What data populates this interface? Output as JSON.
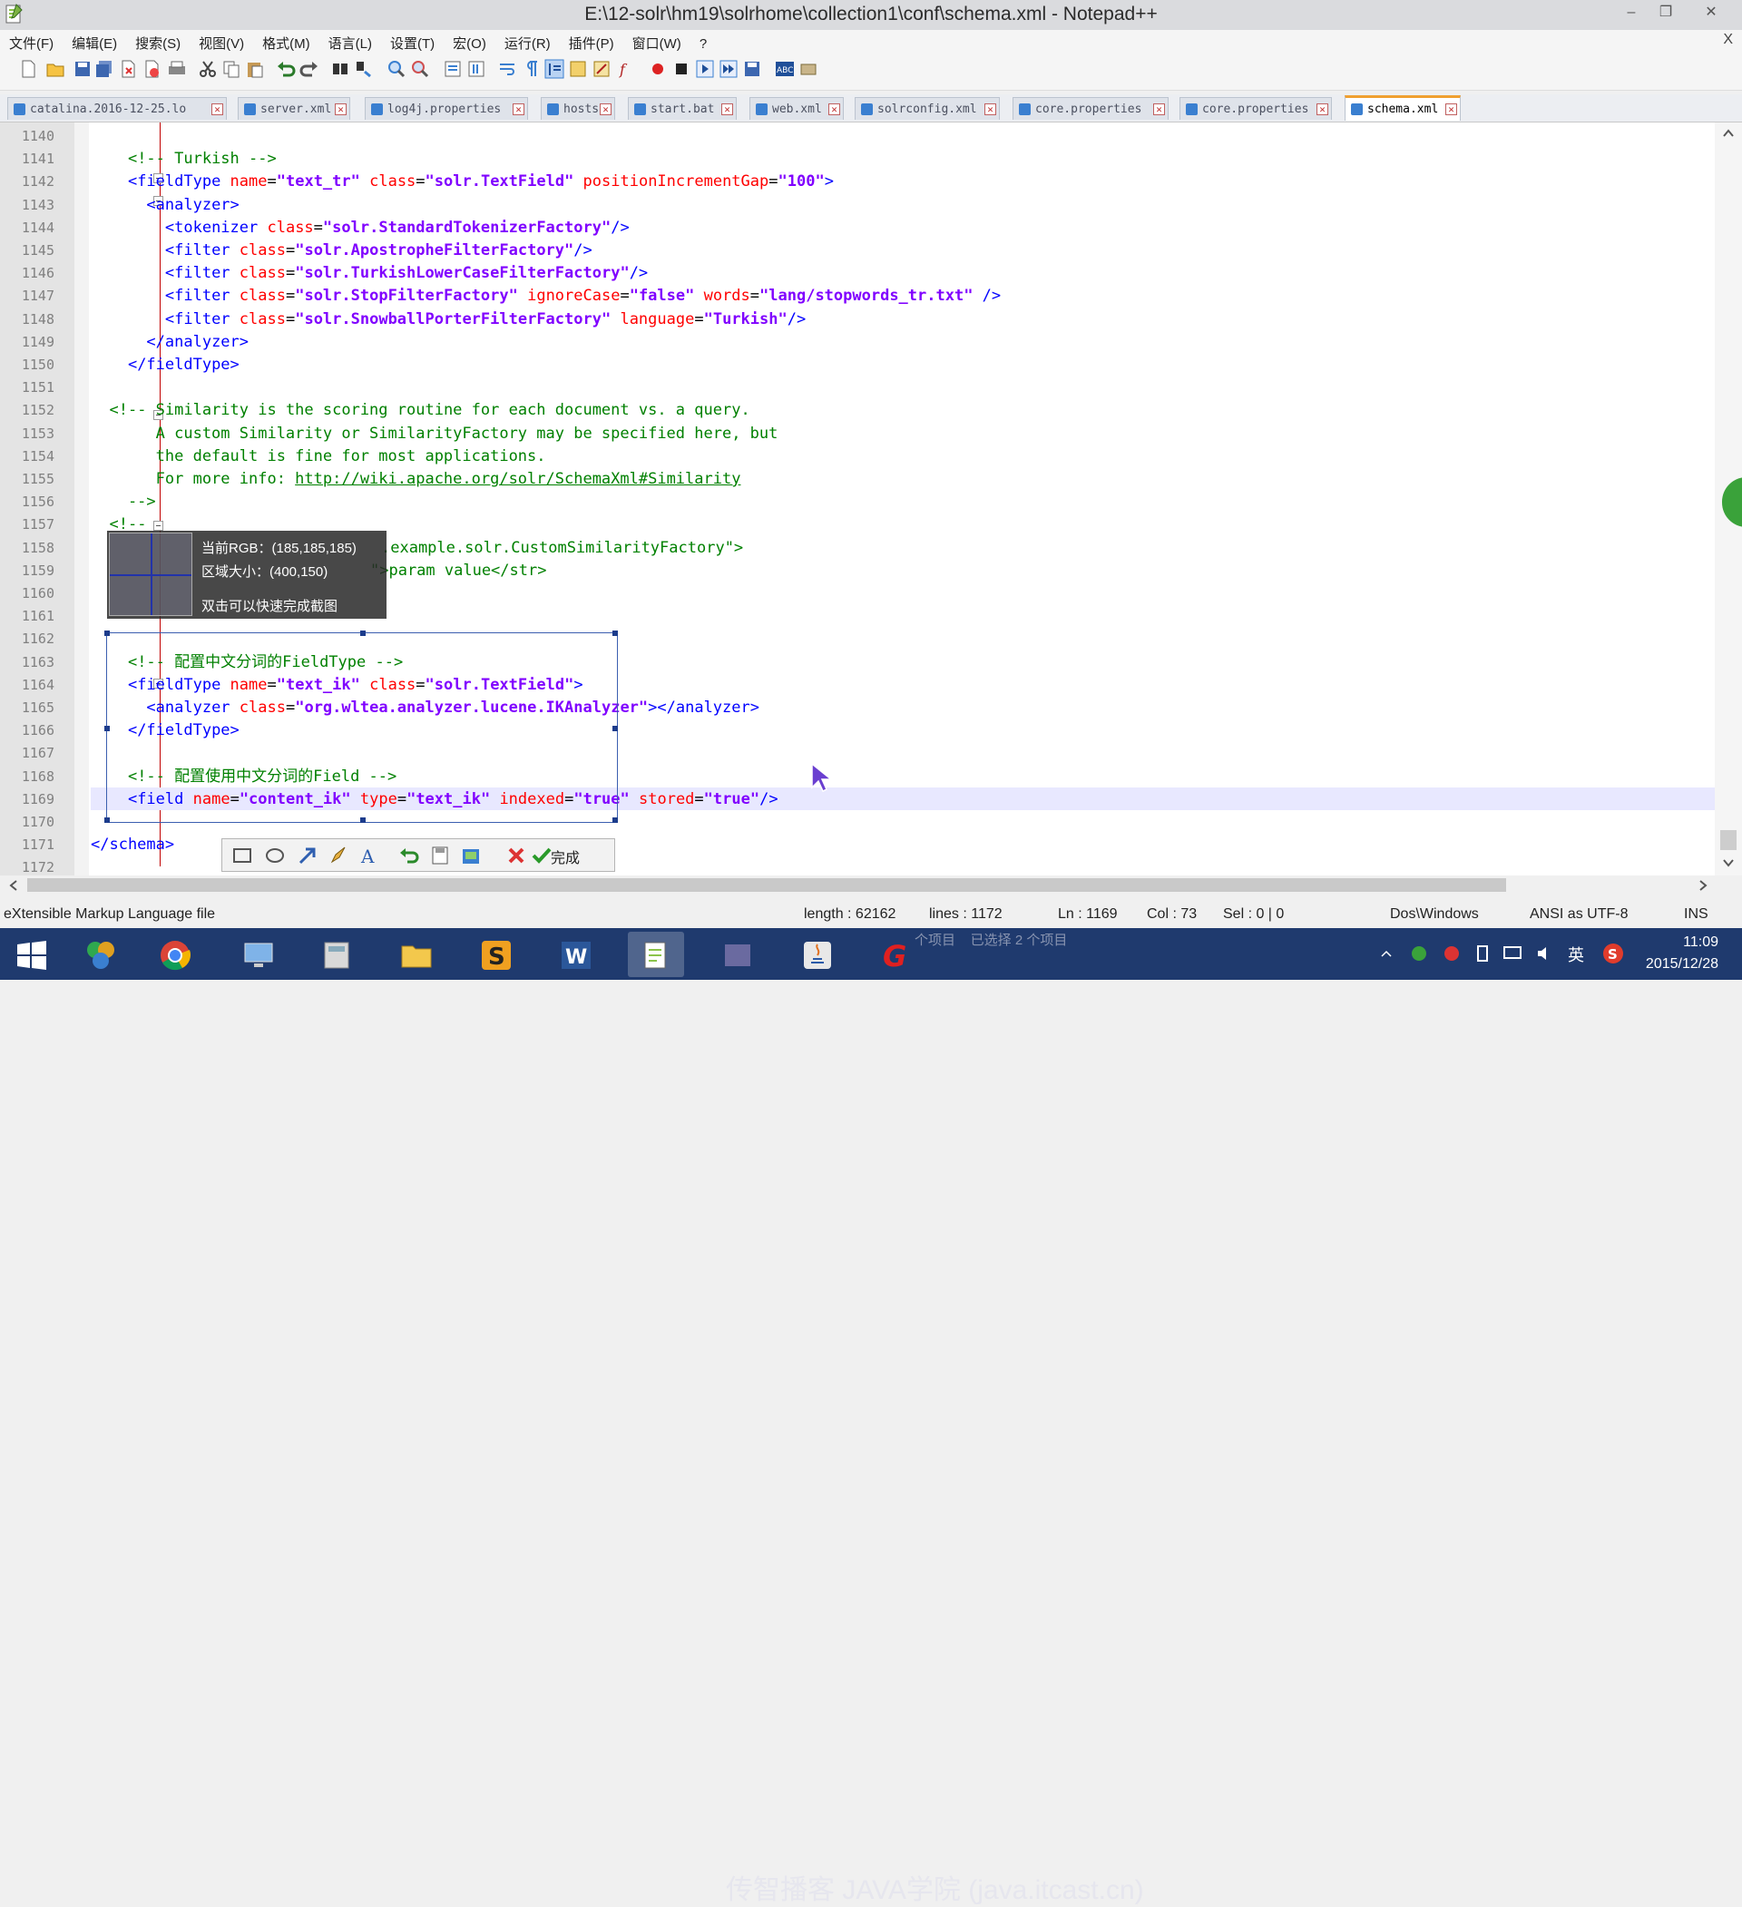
{
  "window": {
    "title": "E:\\12-solr\\hm19\\solrhome\\collection1\\conf\\schema.xml - Notepad++",
    "minimize": "–",
    "restore": "❐",
    "close": "✕"
  },
  "menu": {
    "items": [
      "文件(F)",
      "编辑(E)",
      "搜索(S)",
      "视图(V)",
      "格式(M)",
      "语言(L)",
      "设置(T)",
      "宏(O)",
      "运行(R)",
      "插件(P)",
      "窗口(W)",
      "?"
    ],
    "close_doc": "X"
  },
  "tabs": [
    {
      "label": "catalina.2016-12-25.lo",
      "active": false
    },
    {
      "label": "server.xml",
      "active": false
    },
    {
      "label": "log4j.properties",
      "active": false
    },
    {
      "label": "hosts",
      "active": false
    },
    {
      "label": "start.bat",
      "active": false
    },
    {
      "label": "web.xml",
      "active": false
    },
    {
      "label": "solrconfig.xml",
      "active": false
    },
    {
      "label": "core.properties",
      "active": false
    },
    {
      "label": "core.properties",
      "active": false
    },
    {
      "label": "schema.xml",
      "active": true
    }
  ],
  "editor": {
    "line_numbers": [
      "1140",
      "1141",
      "1142",
      "1143",
      "1144",
      "1145",
      "1146",
      "1147",
      "1148",
      "1149",
      "1150",
      "1151",
      "1152",
      "1153",
      "1154",
      "1155",
      "1156",
      "1157",
      "1158",
      "1159",
      "1160",
      "1161",
      "1162",
      "1163",
      "1164",
      "1165",
      "1166",
      "1167",
      "1168",
      "1169",
      "1170",
      "1171",
      "1172"
    ],
    "lines": [
      [],
      [
        {
          "t": "    ",
          "c": ""
        },
        {
          "t": "<!-- Turkish -->",
          "c": "com"
        }
      ],
      [
        {
          "t": "    ",
          "c": ""
        },
        {
          "t": "<fieldType ",
          "c": "tag"
        },
        {
          "t": "name",
          "c": "attr"
        },
        {
          "t": "=",
          "c": ""
        },
        {
          "t": "\"text_tr\"",
          "c": "val"
        },
        {
          "t": " class",
          "c": "attr"
        },
        {
          "t": "=",
          "c": ""
        },
        {
          "t": "\"solr.TextField\"",
          "c": "val"
        },
        {
          "t": " positionIncrementGap",
          "c": "attr"
        },
        {
          "t": "=",
          "c": ""
        },
        {
          "t": "\"100\"",
          "c": "val"
        },
        {
          "t": ">",
          "c": "tag"
        }
      ],
      [
        {
          "t": "      ",
          "c": ""
        },
        {
          "t": "<analyzer>",
          "c": "tag"
        }
      ],
      [
        {
          "t": "        ",
          "c": ""
        },
        {
          "t": "<tokenizer ",
          "c": "tag"
        },
        {
          "t": "class",
          "c": "attr"
        },
        {
          "t": "=",
          "c": ""
        },
        {
          "t": "\"solr.StandardTokenizerFactory\"",
          "c": "val"
        },
        {
          "t": "/>",
          "c": "tag"
        }
      ],
      [
        {
          "t": "        ",
          "c": ""
        },
        {
          "t": "<filter ",
          "c": "tag"
        },
        {
          "t": "class",
          "c": "attr"
        },
        {
          "t": "=",
          "c": ""
        },
        {
          "t": "\"solr.ApostropheFilterFactory\"",
          "c": "val"
        },
        {
          "t": "/>",
          "c": "tag"
        }
      ],
      [
        {
          "t": "        ",
          "c": ""
        },
        {
          "t": "<filter ",
          "c": "tag"
        },
        {
          "t": "class",
          "c": "attr"
        },
        {
          "t": "=",
          "c": ""
        },
        {
          "t": "\"solr.TurkishLowerCaseFilterFactory\"",
          "c": "val"
        },
        {
          "t": "/>",
          "c": "tag"
        }
      ],
      [
        {
          "t": "        ",
          "c": ""
        },
        {
          "t": "<filter ",
          "c": "tag"
        },
        {
          "t": "class",
          "c": "attr"
        },
        {
          "t": "=",
          "c": ""
        },
        {
          "t": "\"solr.StopFilterFactory\"",
          "c": "val"
        },
        {
          "t": " ignoreCase",
          "c": "attr"
        },
        {
          "t": "=",
          "c": ""
        },
        {
          "t": "\"false\"",
          "c": "val"
        },
        {
          "t": " words",
          "c": "attr"
        },
        {
          "t": "=",
          "c": ""
        },
        {
          "t": "\"lang/stopwords_tr.txt\"",
          "c": "val"
        },
        {
          "t": " />",
          "c": "tag"
        }
      ],
      [
        {
          "t": "        ",
          "c": ""
        },
        {
          "t": "<filter ",
          "c": "tag"
        },
        {
          "t": "class",
          "c": "attr"
        },
        {
          "t": "=",
          "c": ""
        },
        {
          "t": "\"solr.SnowballPorterFilterFactory\"",
          "c": "val"
        },
        {
          "t": " language",
          "c": "attr"
        },
        {
          "t": "=",
          "c": ""
        },
        {
          "t": "\"Turkish\"",
          "c": "val"
        },
        {
          "t": "/>",
          "c": "tag"
        }
      ],
      [
        {
          "t": "      ",
          "c": ""
        },
        {
          "t": "</analyzer>",
          "c": "tag"
        }
      ],
      [
        {
          "t": "    ",
          "c": ""
        },
        {
          "t": "</fieldType>",
          "c": "tag"
        }
      ],
      [],
      [
        {
          "t": "  ",
          "c": ""
        },
        {
          "t": "<!-- Similarity is the scoring routine for each document vs. a query.",
          "c": "com"
        }
      ],
      [
        {
          "t": "       A custom Similarity or SimilarityFactory may be specified here, but",
          "c": "com"
        }
      ],
      [
        {
          "t": "       the default is fine for most applications.",
          "c": "com"
        }
      ],
      [
        {
          "t": "       For more info: ",
          "c": "com"
        },
        {
          "t": "http://wiki.apache.org/solr/SchemaXml#Similarity",
          "c": "link"
        }
      ],
      [
        {
          "t": "    -->",
          "c": "com"
        }
      ],
      [
        {
          "t": "  ",
          "c": ""
        },
        {
          "t": "<!--",
          "c": "com"
        }
      ],
      [
        {
          "t": "                                                                                ",
          "c": ""
        }
      ],
      [],
      [],
      [],
      [],
      [
        {
          "t": "    ",
          "c": ""
        },
        {
          "t": "<!-- 配置中文分词的FieldType -->",
          "c": "com"
        }
      ],
      [
        {
          "t": "    ",
          "c": ""
        },
        {
          "t": "<fieldType ",
          "c": "tag"
        },
        {
          "t": "name",
          "c": "attr"
        },
        {
          "t": "=",
          "c": ""
        },
        {
          "t": "\"text_ik\"",
          "c": "val"
        },
        {
          "t": " class",
          "c": "attr"
        },
        {
          "t": "=",
          "c": ""
        },
        {
          "t": "\"solr.TextField\"",
          "c": "val"
        },
        {
          "t": ">",
          "c": "tag"
        }
      ],
      [
        {
          "t": "      ",
          "c": ""
        },
        {
          "t": "<analyzer ",
          "c": "tag"
        },
        {
          "t": "class",
          "c": "attr"
        },
        {
          "t": "=",
          "c": ""
        },
        {
          "t": "\"org.wltea.analyzer.lucene.IKAnalyzer\"",
          "c": "val"
        },
        {
          "t": "></analyzer>",
          "c": "tag"
        }
      ],
      [
        {
          "t": "    ",
          "c": ""
        },
        {
          "t": "</fieldType>",
          "c": "tag"
        }
      ],
      [],
      [
        {
          "t": "    ",
          "c": ""
        },
        {
          "t": "<!-- 配置使用中文分词的Field -->",
          "c": "com"
        }
      ],
      [
        {
          "t": "    ",
          "c": ""
        },
        {
          "t": "<field ",
          "c": "tag"
        },
        {
          "t": "name",
          "c": "attr"
        },
        {
          "t": "=",
          "c": ""
        },
        {
          "t": "\"content_ik\"",
          "c": "val"
        },
        {
          "t": " type",
          "c": "attr"
        },
        {
          "t": "=",
          "c": ""
        },
        {
          "t": "\"text_ik\"",
          "c": "val"
        },
        {
          "t": " indexed",
          "c": "attr"
        },
        {
          "t": "=",
          "c": ""
        },
        {
          "t": "\"true\"",
          "c": "val"
        },
        {
          "t": " stored",
          "c": "attr"
        },
        {
          "t": "=",
          "c": ""
        },
        {
          "t": "\"true\"",
          "c": "val"
        },
        {
          "t": "/>",
          "c": "tag"
        }
      ],
      [],
      [
        {
          "t": "</schema>",
          "c": "tag"
        }
      ],
      []
    ],
    "partial_lines": [
      {
        "line": "1158",
        "text": ".example.solr.CustomSimilarityFactory\">"
      },
      {
        "line": "1159",
        "text": "\">param value</str>"
      }
    ],
    "highlighted_line": "1169"
  },
  "snip_overlay": {
    "rgb_label": "当前RGB：(185,185,185)",
    "size_label": "区域大小：(400,150)",
    "hint": "双击可以快速完成截图",
    "done_label": "完成"
  },
  "status": {
    "file_type": "eXtensible Markup Language file",
    "length": "length : 62162",
    "lines": "lines : 1172",
    "ln": "Ln : 1169",
    "col": "Col : 73",
    "sel": "Sel : 0 | 0",
    "eol": "Dos\\Windows",
    "encoding": "ANSI as UTF-8",
    "mode": "INS"
  },
  "taskbar": {
    "time": "11:09",
    "date": "2015/12/28",
    "ime": "英",
    "watermark": "传智播客 JAVA学院 (java.itcast.cn)",
    "explorer_text": "个项目    已选择 2 个项目"
  },
  "colors": {
    "tag": "#0000ff",
    "attr": "#ff0000",
    "value": "#8000ff",
    "comment": "#008000",
    "taskbar": "#1f3a6e",
    "active_tab_accent": "#f0a030"
  }
}
